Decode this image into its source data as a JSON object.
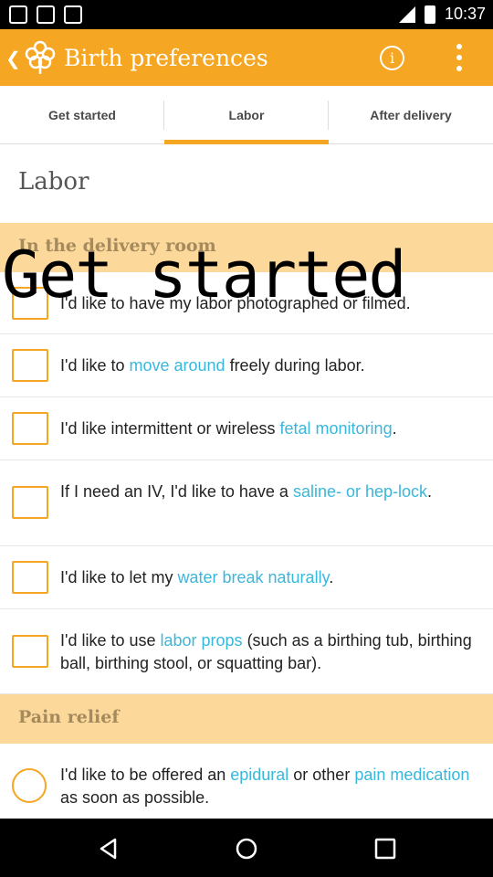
{
  "status_bar": {
    "time": "10:37"
  },
  "app_bar": {
    "title": "Birth preferences"
  },
  "tabs": [
    {
      "label": "Get started",
      "active": false
    },
    {
      "label": "Labor",
      "active": true
    },
    {
      "label": "After delivery",
      "active": false
    }
  ],
  "page": {
    "section_title": "Labor"
  },
  "overlay_text": "Get started",
  "groups": [
    {
      "title": "In the delivery room",
      "items": [
        {
          "before": "I'd like to have my labor photographed or filmed.",
          "link": "",
          "after": "",
          "link2": "",
          "after2": ""
        },
        {
          "before": "I'd like to ",
          "link": "move around",
          "after": " freely during labor.",
          "link2": "",
          "after2": ""
        },
        {
          "before": "I'd like intermittent or wireless ",
          "link": "fetal monitoring",
          "after": ".",
          "link2": "",
          "after2": ""
        },
        {
          "before": "If I need an IV, I'd like to have a ",
          "link": "saline- or hep-lock",
          "after": ".",
          "link2": "",
          "after2": ""
        },
        {
          "before": "I'd like to let my ",
          "link": "water break naturally",
          "after": ".",
          "link2": "",
          "after2": ""
        },
        {
          "before": "I'd like to use ",
          "link": "labor props",
          "after": " (such as a birthing tub, birthing ball, birthing stool, or squatting bar).",
          "link2": "",
          "after2": ""
        }
      ]
    },
    {
      "title": "Pain relief",
      "items": [
        {
          "before": "I'd like to be offered an ",
          "link": "epidural",
          "after": " or other ",
          "link2": "pain medication",
          "after2": " as soon as possible."
        }
      ]
    }
  ],
  "colors": {
    "accent": "#f5a623",
    "link": "#3ab7db",
    "group_bg": "#fcd99a"
  },
  "icons": [
    "back-icon",
    "flower-logo-icon",
    "info-icon",
    "more-vert-icon",
    "nav-back-icon",
    "nav-home-icon",
    "nav-recents-icon"
  ]
}
